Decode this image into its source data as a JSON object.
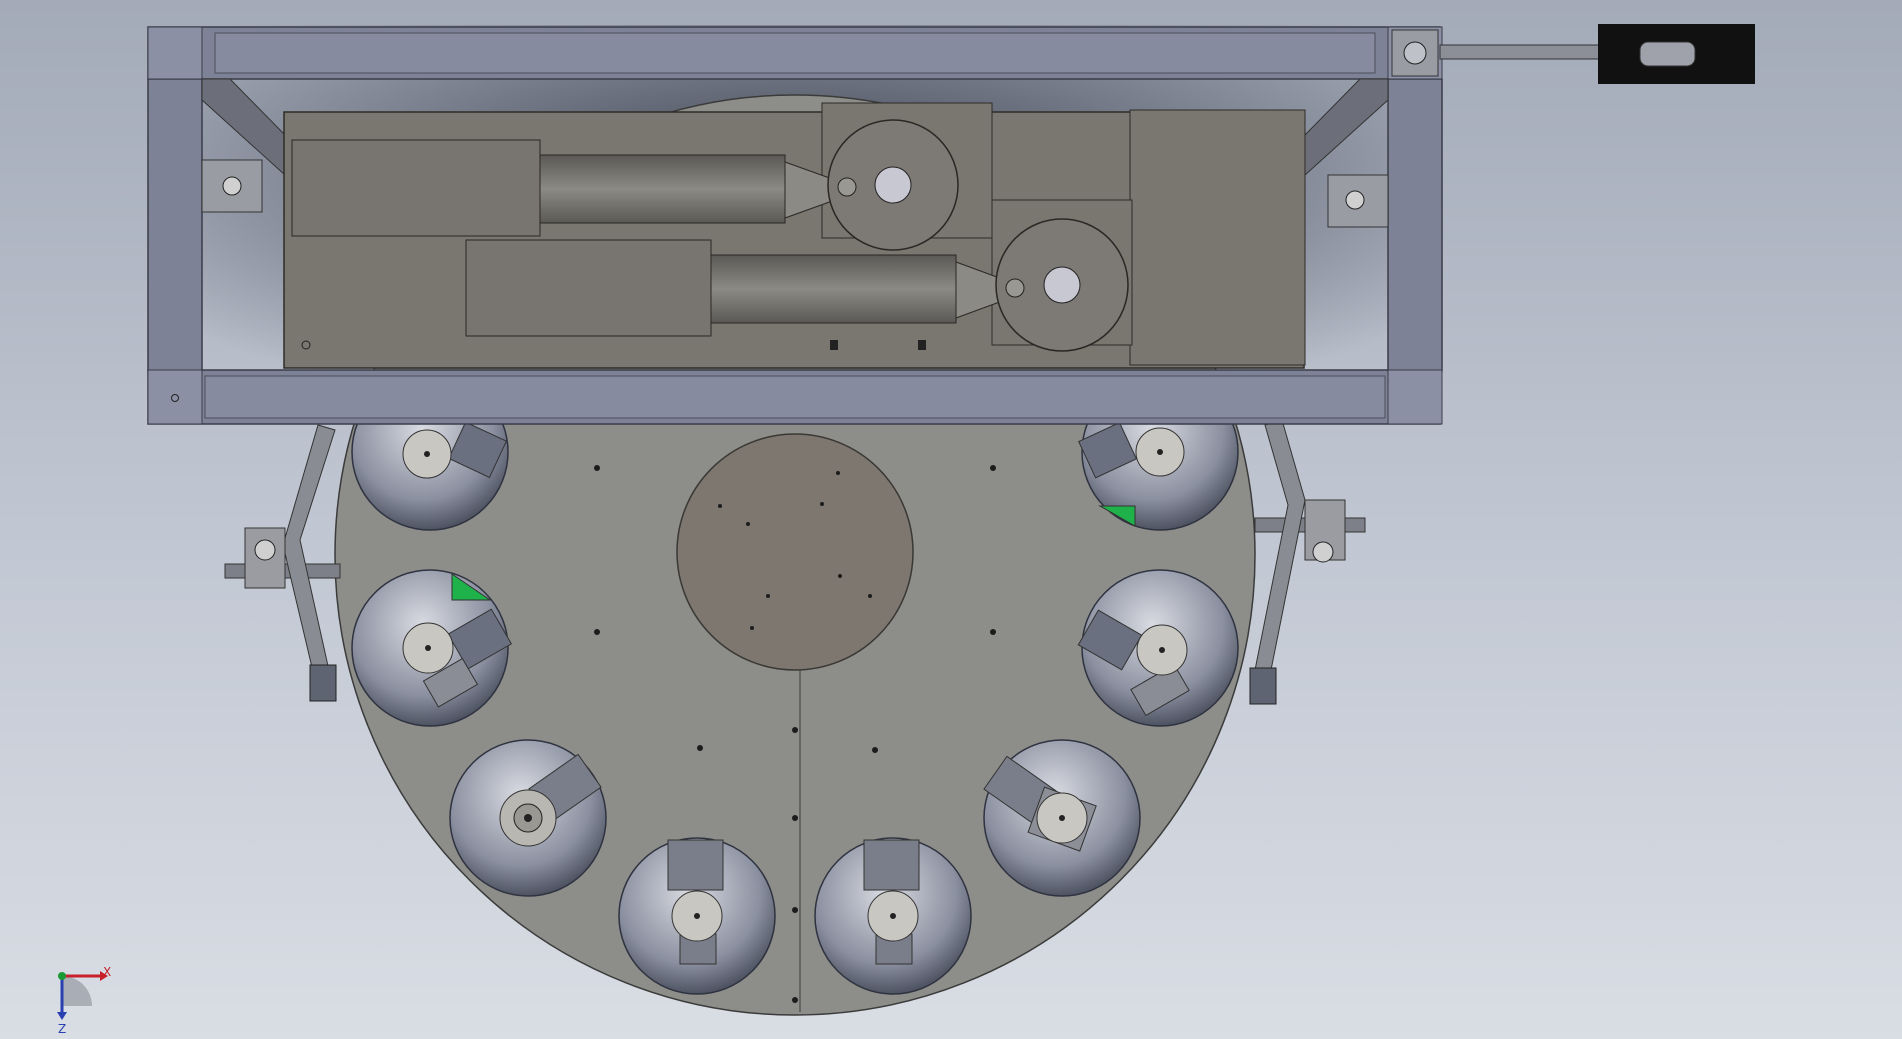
{
  "viewport": {
    "background_top": "#a3aab8",
    "background_bottom": "#d9dde4",
    "colors": {
      "frame_fill": "#7d8296",
      "frame_dark": "#5f6475",
      "plate_fill": "#8d8d89",
      "body_fill": "#7a7670",
      "pocket_fill": "#5e6472",
      "accent_green": "#1fb24a",
      "handle_fill": "#111111"
    }
  },
  "components": {
    "rotary_table": "rotary-table",
    "pocket_count": 10,
    "linear_actuators": 2,
    "side_brackets": 2
  },
  "triad": {
    "x_label": "X",
    "z_label": "Z",
    "x_color": "#c8202a",
    "y_color": "#1a9a35",
    "z_color": "#2a3fb0"
  }
}
